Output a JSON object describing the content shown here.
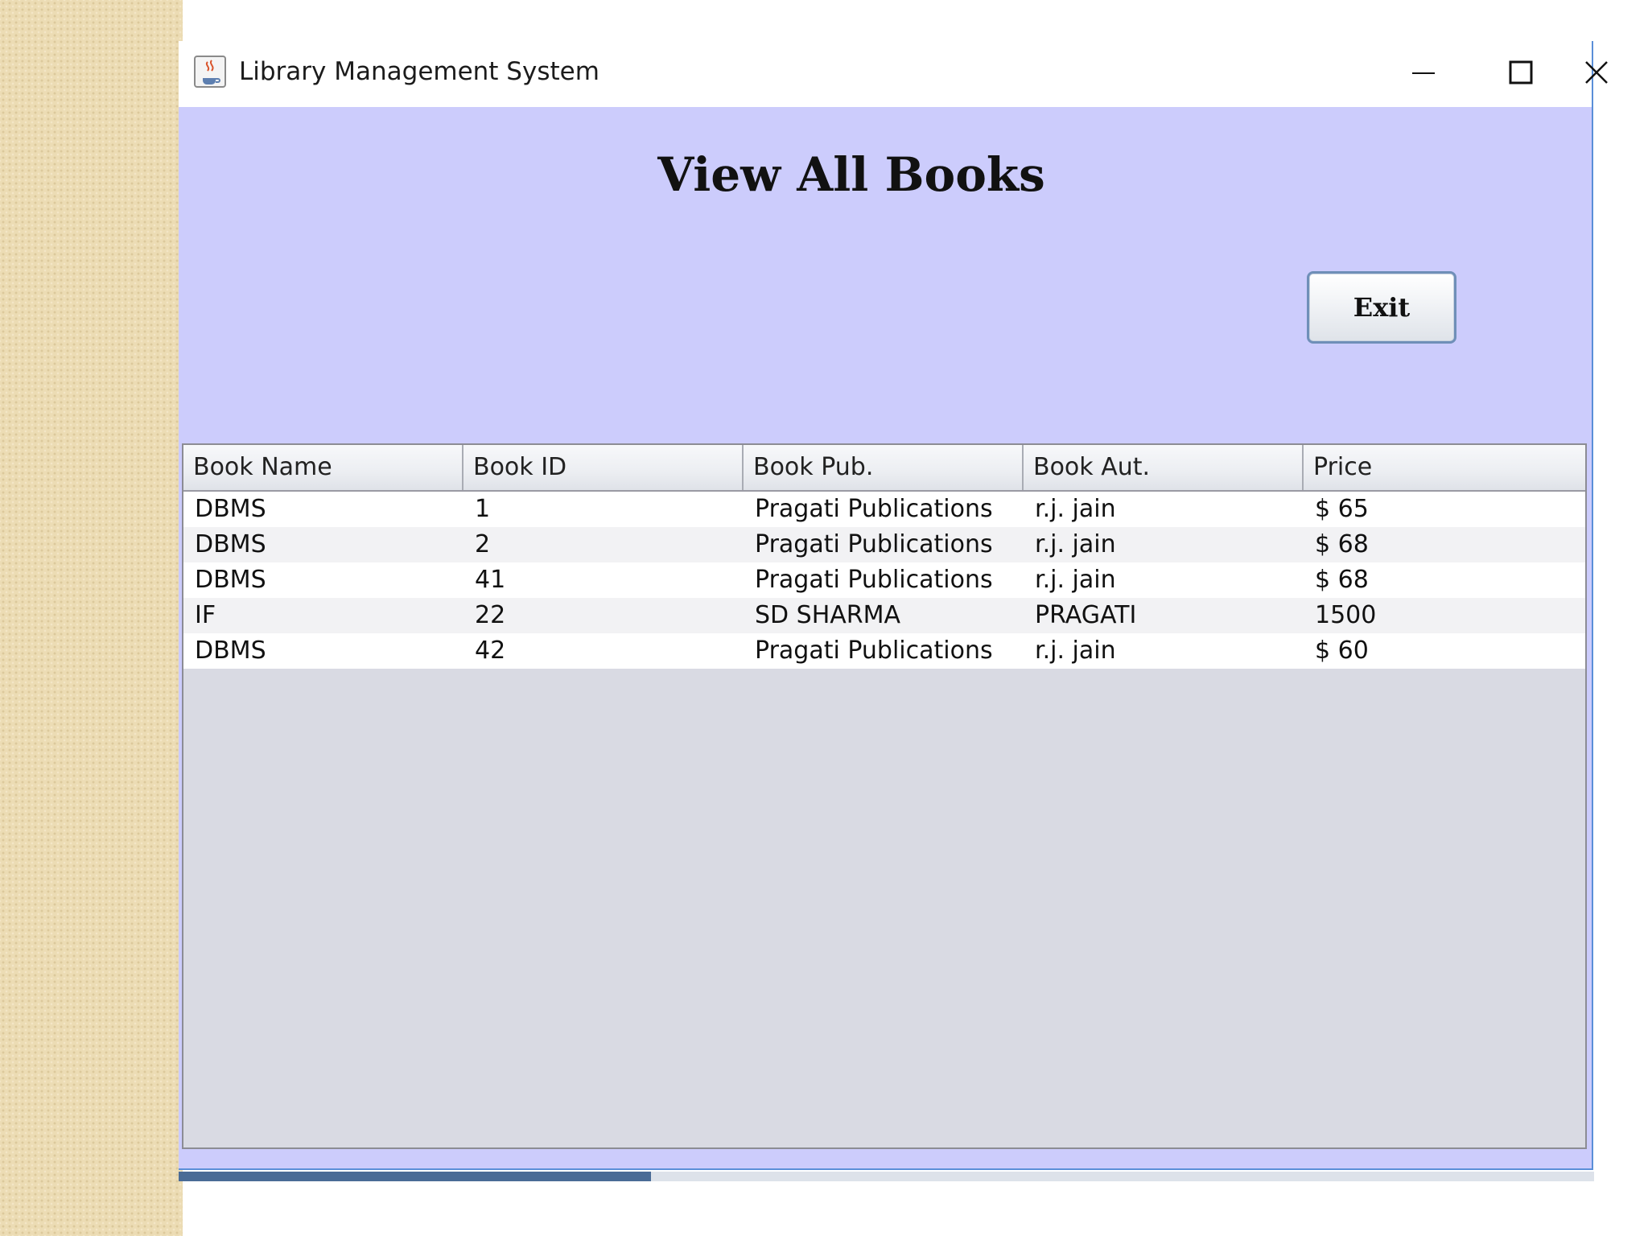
{
  "window": {
    "title": "Library Management System"
  },
  "page": {
    "heading": "View All Books",
    "exit_label": "Exit"
  },
  "table": {
    "columns": [
      "Book Name",
      "Book ID",
      "Book Pub.",
      "Book Aut.",
      "Price"
    ],
    "rows": [
      [
        "DBMS",
        "1",
        "Pragati Publications",
        "r.j. jain",
        "$ 65"
      ],
      [
        "DBMS",
        "2",
        "Pragati Publications",
        "r.j. jain",
        "$ 68"
      ],
      [
        "DBMS",
        "41",
        "Pragati Publications",
        "r.j. jain",
        "$ 68"
      ],
      [
        "IF",
        "22",
        "SD SHARMA",
        "PRAGATI",
        "1500"
      ],
      [
        "DBMS",
        "42",
        "Pragati Publications",
        "r.j. jain",
        "$ 60"
      ]
    ]
  },
  "colors": {
    "content_background": "#ccccfc",
    "window_border": "#5a8fd8",
    "table_empty_area": "#d9dae3"
  },
  "icons": {
    "app": "java-coffee-icon",
    "minimize": "minimize-icon",
    "maximize": "maximize-icon",
    "close": "close-icon"
  }
}
